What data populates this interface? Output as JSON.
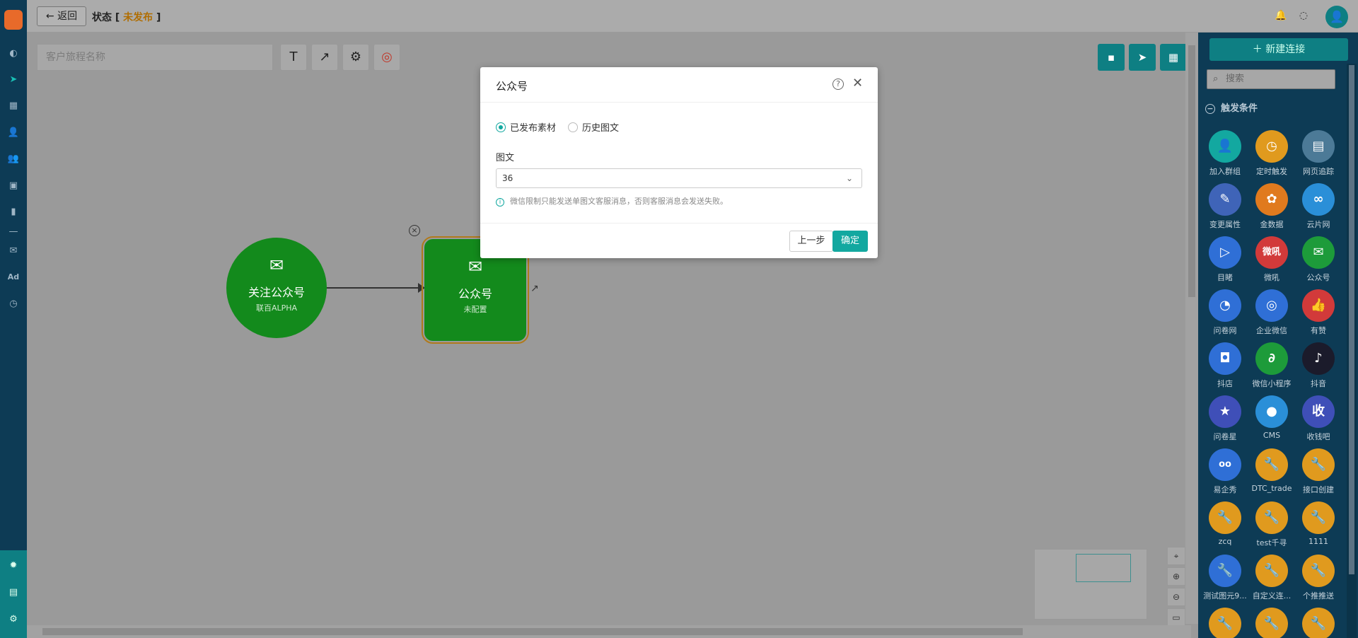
{
  "topbar": {
    "back_label": "返回",
    "status_label": "状态 [",
    "status_value": "未发布",
    "status_close": "]"
  },
  "toolbar": {
    "journey_name_placeholder": "客户旅程名称"
  },
  "nodes": [
    {
      "title": "关注公众号",
      "sub": "联百ALPHA"
    },
    {
      "title": "公众号",
      "sub": "未配置"
    }
  ],
  "right_panel": {
    "new_connection_label": "新建连接",
    "search_placeholder": "搜索",
    "section_title": "触发条件",
    "tiles": [
      {
        "label": "加入群组",
        "glyph": "👤",
        "color": "#13a8a0"
      },
      {
        "label": "定时触发",
        "glyph": "◷",
        "color": "#e09a1e"
      },
      {
        "label": "网页追踪",
        "glyph": "▤",
        "color": "#4c7a97"
      },
      {
        "label": "变更属性",
        "glyph": "✎",
        "color": "#3f64b8"
      },
      {
        "label": "金数据",
        "glyph": "✿",
        "color": "#e07a1e"
      },
      {
        "label": "云片网",
        "glyph": "∞",
        "color": "#2a8fd8"
      },
      {
        "label": "目睹",
        "glyph": "▷",
        "color": "#2f6fd6"
      },
      {
        "label": "微吼",
        "glyph": "微吼",
        "color": "#d23a3a"
      },
      {
        "label": "公众号",
        "glyph": "✉",
        "color": "#1d9b3a"
      },
      {
        "label": "问卷网",
        "glyph": "◔",
        "color": "#2f6fd6"
      },
      {
        "label": "企业微信",
        "glyph": "◎",
        "color": "#2f6fd6"
      },
      {
        "label": "有赞",
        "glyph": "👍",
        "color": "#d23a3a"
      },
      {
        "label": "抖店",
        "glyph": "◘",
        "color": "#2f6fd6"
      },
      {
        "label": "微信小程序",
        "glyph": "∂",
        "color": "#1d9b3a"
      },
      {
        "label": "抖音",
        "glyph": "♪",
        "color": "#1b1b2b"
      },
      {
        "label": "问卷星",
        "glyph": "★",
        "color": "#3f4fb8"
      },
      {
        "label": "CMS",
        "glyph": "●",
        "color": "#2a8fd8"
      },
      {
        "label": "收钱吧",
        "glyph": "收",
        "color": "#3f4fb8"
      },
      {
        "label": "易企秀",
        "glyph": "oo",
        "color": "#2f6fd6"
      },
      {
        "label": "DTC_trade",
        "glyph": "🔧",
        "color": "#e09a1e"
      },
      {
        "label": "接口创建",
        "glyph": "🔧",
        "color": "#e09a1e"
      },
      {
        "label": "zcq",
        "glyph": "🔧",
        "color": "#e09a1e"
      },
      {
        "label": "test千寻",
        "glyph": "🔧",
        "color": "#e09a1e"
      },
      {
        "label": "1111",
        "glyph": "🔧",
        "color": "#e09a1e"
      },
      {
        "label": "测试图元9...",
        "glyph": "🔧",
        "color": "#2f6fd6"
      },
      {
        "label": "自定义连...",
        "glyph": "🔧",
        "color": "#e09a1e"
      },
      {
        "label": "个推推送",
        "glyph": "🔧",
        "color": "#e09a1e"
      },
      {
        "label": "",
        "glyph": "🔧",
        "color": "#e09a1e"
      },
      {
        "label": "",
        "glyph": "🔧",
        "color": "#e09a1e"
      },
      {
        "label": "",
        "glyph": "🔧",
        "color": "#e09a1e"
      }
    ]
  },
  "modal": {
    "title": "公众号",
    "radio_published": "已发布素材",
    "radio_history": "历史图文",
    "field_label": "图文",
    "select_value": "36",
    "hint": "微信限制只能发送单图文客服消息，否则客服消息会发送失败。",
    "btn_prev": "上一步",
    "btn_ok": "确定"
  },
  "colors": {
    "accent": "#13a8a0",
    "nav": "#0d3b55",
    "node": "#138a1c"
  }
}
